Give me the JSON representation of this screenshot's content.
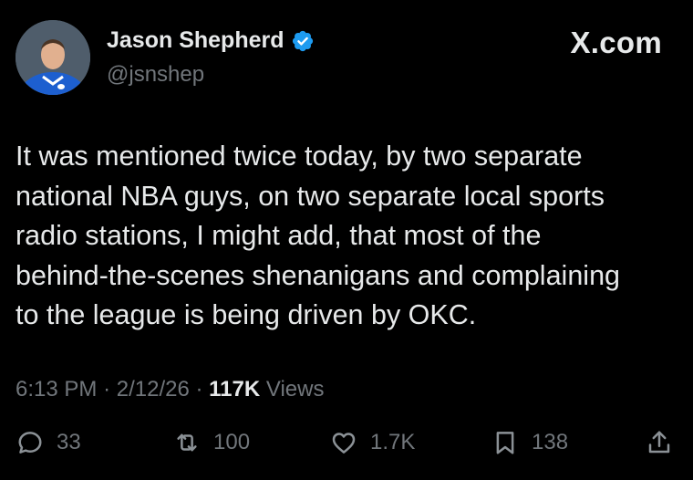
{
  "author": {
    "name": "Jason Shepherd",
    "handle": "@jsnshep",
    "verified": true
  },
  "brand": "X.com",
  "tweet": {
    "lines": [
      "It was mentioned twice today, by two separate",
      "national NBA guys, on two separate local sports",
      "radio stations, I might add, that most of the",
      "behind-the-scenes shenanigans and complaining",
      "to the league is being driven by OKC."
    ]
  },
  "meta": {
    "time": "6:13 PM",
    "sep1": "·",
    "date": "2/12/26",
    "sep2": "·",
    "views_count": "117K",
    "views_label": "Views"
  },
  "actions": {
    "replies": "33",
    "reposts": "100",
    "likes": "1.7K",
    "bookmarks": "138"
  },
  "colors": {
    "background": "#000000",
    "text": "#e7e9ea",
    "secondary": "#71767b",
    "verified_badge": "#1d9bf0",
    "avatar_shirt": "#1d5fcf"
  },
  "icons": [
    "verified-badge-icon",
    "reply-icon",
    "repost-icon",
    "like-icon",
    "bookmark-icon",
    "share-icon"
  ]
}
